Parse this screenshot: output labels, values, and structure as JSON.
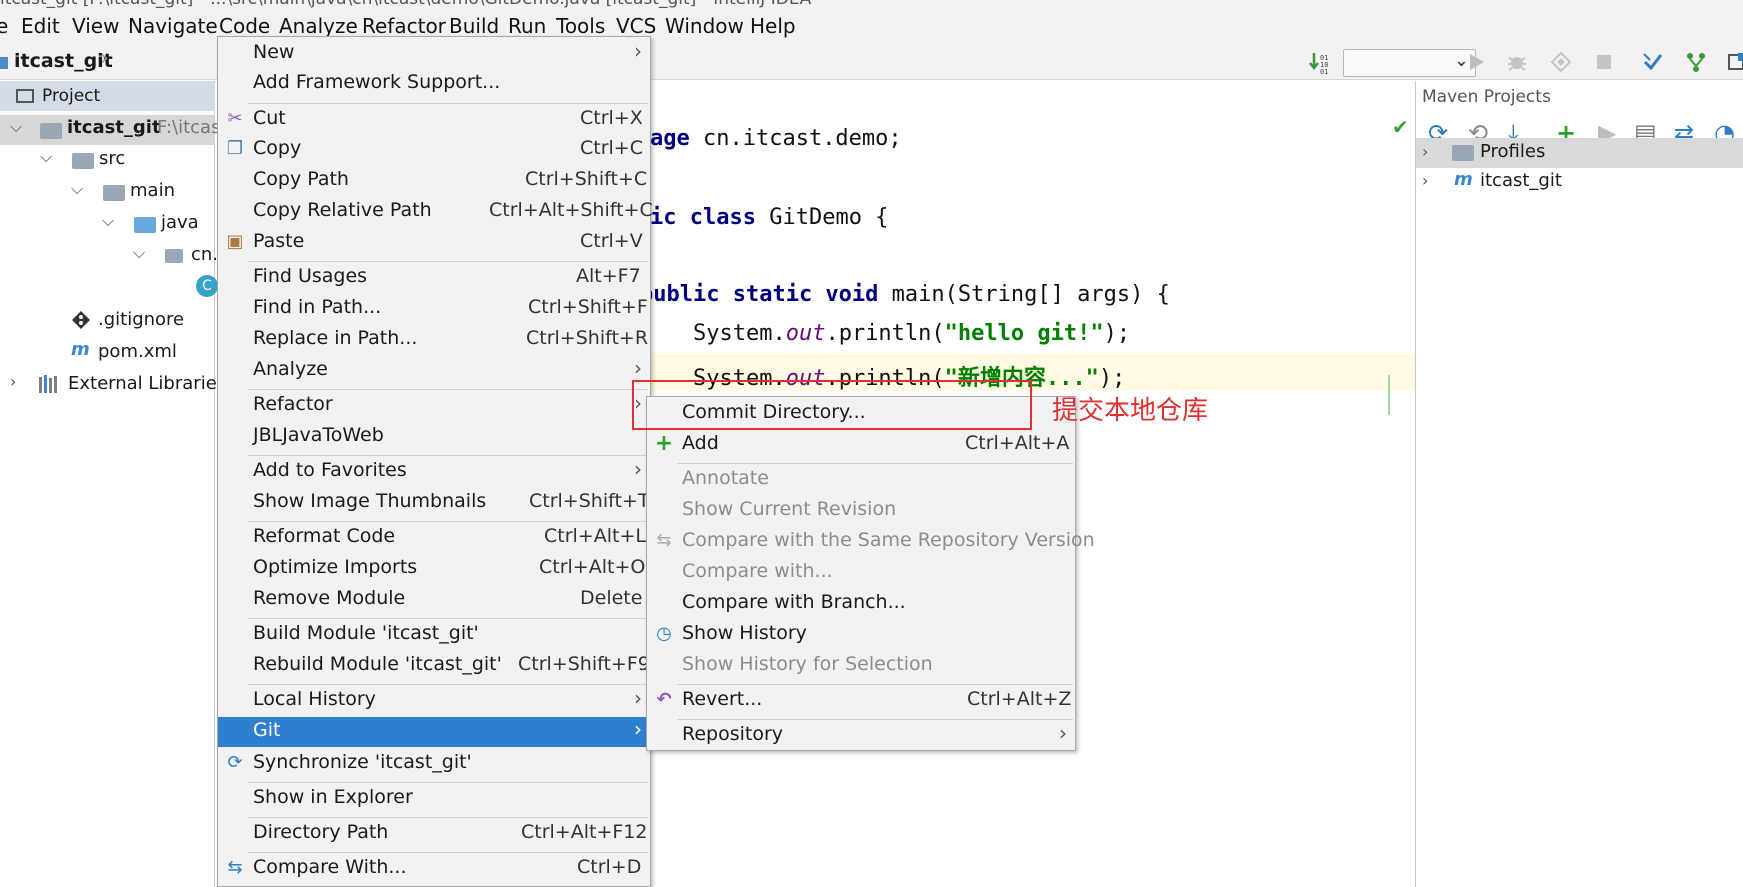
{
  "title_bar": "itcast_git [F:\\itcast_git] - ...\\src\\main\\java\\cn\\itcast\\demo\\GitDemo.java [itcast_git] - IntelliJ IDEA",
  "menu": [
    "e",
    "Edit",
    "View",
    "Navigate",
    "Code",
    "Analyze",
    "Refactor",
    "Build",
    "Run",
    "Tools",
    "VCS",
    "Window",
    "Help"
  ],
  "breadcrumb": "itcast_git",
  "project": {
    "header": "Project",
    "root_name": "itcast_git",
    "root_path": "F:\\itcast",
    "src": "src",
    "main": "main",
    "java": "java",
    "pkg": "cn.",
    "class_icon": "C",
    "gitignore": ".gitignore",
    "pom": "pom.xml",
    "external": "External Libraries"
  },
  "editor": {
    "line1_a": "age ",
    "line1_b": "cn.itcast.demo;",
    "line2_a": "ic class ",
    "line2_b": "GitDemo {",
    "line3_a": "public static void ",
    "line3_b": "main(String[] args) {",
    "line4_a": "    System.",
    "line4_f": "out",
    "line4_b": ".println(",
    "line4_s": "\"hello git!\"",
    "line4_c": ");",
    "line5_a": "    System.",
    "line5_f": "out",
    "line5_b": ".println(",
    "line5_s": "\"新增内容...\"",
    "line5_c": ");"
  },
  "maven": {
    "title": "Maven Projects",
    "rows": [
      "Profiles",
      "itcast_git"
    ]
  },
  "context_menu": [
    {
      "label": "New",
      "shortcut": "",
      "submenu": true
    },
    {
      "label": "Add Framework Support...",
      "shortcut": ""
    },
    {
      "label": "Cut",
      "shortcut": "Ctrl+X",
      "icon": "cut-icon"
    },
    {
      "label": "Copy",
      "shortcut": "Ctrl+C",
      "icon": "copy-icon"
    },
    {
      "label": "Copy Path",
      "shortcut": "Ctrl+Shift+C"
    },
    {
      "label": "Copy Relative Path",
      "shortcut": "Ctrl+Alt+Shift+C"
    },
    {
      "label": "Paste",
      "shortcut": "Ctrl+V",
      "icon": "paste-icon"
    },
    {
      "label": "Find Usages",
      "shortcut": "Alt+F7"
    },
    {
      "label": "Find in Path...",
      "shortcut": "Ctrl+Shift+F"
    },
    {
      "label": "Replace in Path...",
      "shortcut": "Ctrl+Shift+R"
    },
    {
      "label": "Analyze",
      "shortcut": "",
      "submenu": true
    },
    {
      "label": "Refactor",
      "shortcut": "",
      "submenu": true
    },
    {
      "label": "JBLJavaToWeb",
      "shortcut": ""
    },
    {
      "label": "Add to Favorites",
      "shortcut": "",
      "submenu": true
    },
    {
      "label": "Show Image Thumbnails",
      "shortcut": "Ctrl+Shift+T"
    },
    {
      "label": "Reformat Code",
      "shortcut": "Ctrl+Alt+L"
    },
    {
      "label": "Optimize Imports",
      "shortcut": "Ctrl+Alt+O"
    },
    {
      "label": "Remove Module",
      "shortcut": "Delete"
    },
    {
      "label": "Build Module 'itcast_git'",
      "shortcut": ""
    },
    {
      "label": "Rebuild Module 'itcast_git'",
      "shortcut": "Ctrl+Shift+F9"
    },
    {
      "label": "Local History",
      "shortcut": "",
      "submenu": true
    },
    {
      "label": "Git",
      "shortcut": "",
      "submenu": true,
      "highlighted": true
    },
    {
      "label": "Synchronize 'itcast_git'",
      "shortcut": "",
      "icon": "sync-icon"
    },
    {
      "label": "Show in Explorer",
      "shortcut": ""
    },
    {
      "label": "Directory Path",
      "shortcut": "Ctrl+Alt+F12"
    },
    {
      "label": "Compare With...",
      "shortcut": "Ctrl+D",
      "icon": "compare-icon"
    }
  ],
  "git_menu": [
    {
      "label": "Commit Directory...",
      "shortcut": ""
    },
    {
      "label": "Add",
      "shortcut": "Ctrl+Alt+A",
      "icon": "plus-icon"
    },
    {
      "label": "Annotate",
      "shortcut": "",
      "disabled": true
    },
    {
      "label": "Show Current Revision",
      "shortcut": "",
      "disabled": true
    },
    {
      "label": "Compare with the Same Repository Version",
      "shortcut": "",
      "disabled": true
    },
    {
      "label": "Compare with...",
      "shortcut": "",
      "disabled": true
    },
    {
      "label": "Compare with Branch...",
      "shortcut": ""
    },
    {
      "label": "Show History",
      "shortcut": "",
      "icon": "history-icon"
    },
    {
      "label": "Show History for Selection",
      "shortcut": "",
      "disabled": true
    },
    {
      "label": "Revert...",
      "shortcut": "Ctrl+Alt+Z",
      "icon": "revert-icon"
    },
    {
      "label": "Repository",
      "shortcut": "",
      "submenu": true
    }
  ],
  "annotation": "提交本地仓库",
  "colors": {
    "highlight": "#2f7fd1",
    "annotation": "#e03030",
    "keyword": "#000080",
    "string": "#008000"
  }
}
